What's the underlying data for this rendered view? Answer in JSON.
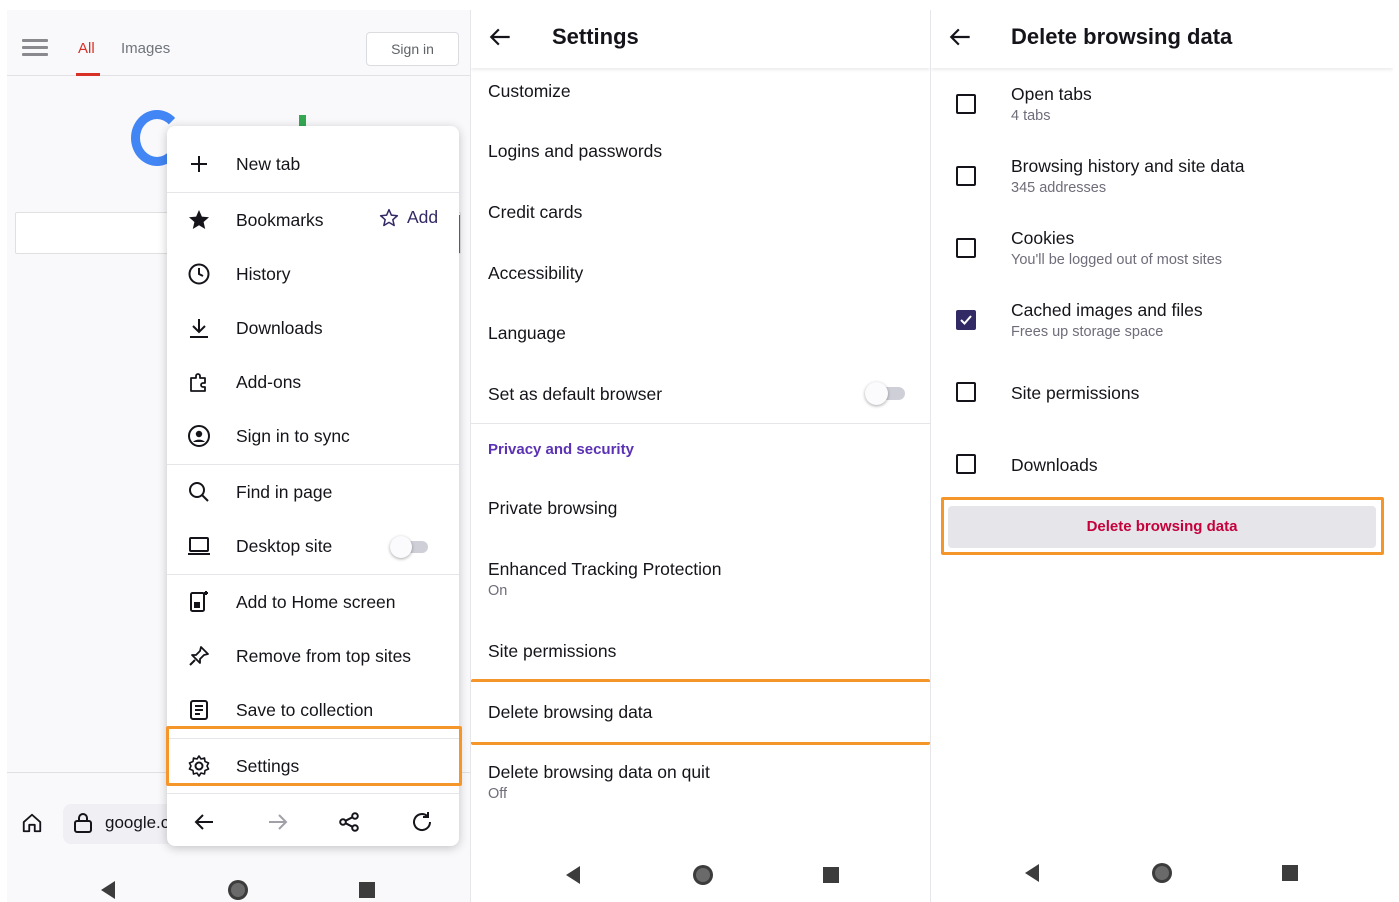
{
  "browser": {
    "tabs": [
      "All",
      "Images"
    ],
    "sign_in": "Sign in",
    "address": "google.c",
    "menu": {
      "new_tab": "New tab",
      "bookmarks": "Bookmarks",
      "bookmarks_add": "Add",
      "history": "History",
      "downloads": "Downloads",
      "addons": "Add-ons",
      "sign_in_sync": "Sign in to sync",
      "find_in_page": "Find in page",
      "desktop_site": "Desktop site",
      "add_home": "Add to Home screen",
      "remove_top": "Remove from top sites",
      "save_collection": "Save to collection",
      "settings": "Settings"
    }
  },
  "settings": {
    "title": "Settings",
    "items": {
      "customize": "Customize",
      "logins": "Logins and passwords",
      "credit_cards": "Credit cards",
      "accessibility": "Accessibility",
      "language": "Language",
      "default_browser": "Set as default browser",
      "privacy_heading": "Privacy and security",
      "private_browsing": "Private browsing",
      "etp": "Enhanced Tracking Protection",
      "etp_status": "On",
      "site_permissions": "Site permissions",
      "delete_data": "Delete browsing data",
      "delete_on_quit": "Delete browsing data on quit",
      "delete_on_quit_status": "Off"
    }
  },
  "delete_data": {
    "title": "Delete browsing data",
    "options": [
      {
        "label": "Open tabs",
        "sub": "4 tabs",
        "checked": false
      },
      {
        "label": "Browsing history and site data",
        "sub": "345 addresses",
        "checked": false
      },
      {
        "label": "Cookies",
        "sub": "You'll be logged out of most sites",
        "checked": false
      },
      {
        "label": "Cached images and files",
        "sub": "Frees up storage space",
        "checked": true
      },
      {
        "label": "Site permissions",
        "sub": "",
        "checked": false
      },
      {
        "label": "Downloads",
        "sub": "",
        "checked": false
      }
    ],
    "button": "Delete browsing data"
  },
  "colors": {
    "highlight": "#f5962a",
    "accent": "#312a65",
    "privacy_heading": "#5b32b4",
    "danger": "#c5003b"
  }
}
